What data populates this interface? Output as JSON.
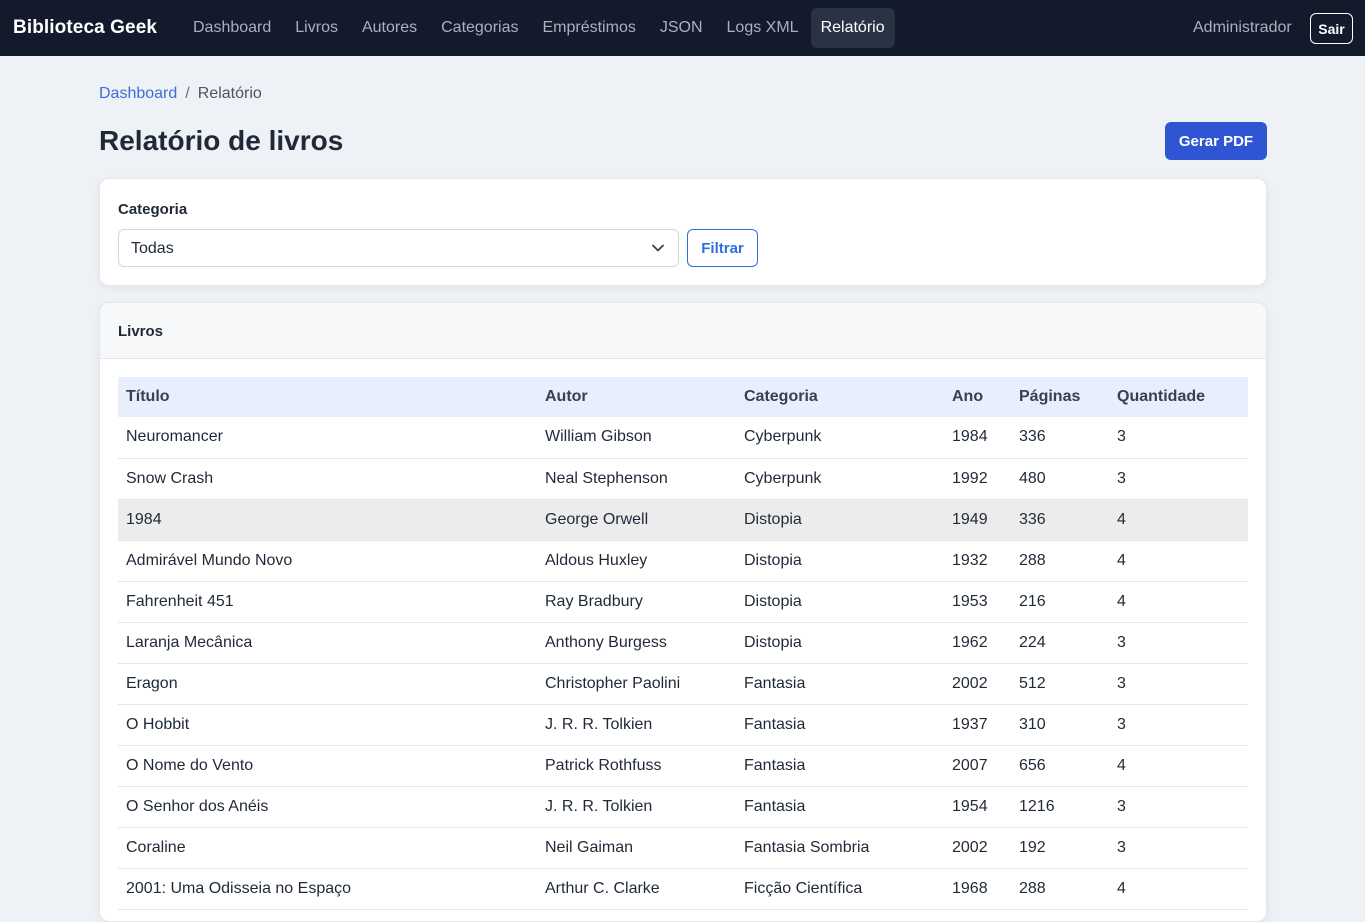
{
  "navbar": {
    "brand": "Biblioteca Geek",
    "links": [
      "Dashboard",
      "Livros",
      "Autores",
      "Categorias",
      "Empréstimos",
      "JSON",
      "Logs XML",
      "Relatório"
    ],
    "active": "Relatório",
    "user": "Administrador",
    "logout_label": "Sair"
  },
  "breadcrumb": {
    "home": "Dashboard",
    "separator": "/",
    "current": "Relatório"
  },
  "page": {
    "title": "Relatório de livros",
    "pdf_button": "Gerar PDF"
  },
  "filter": {
    "label": "Categoria",
    "selected": "Todas",
    "button": "Filtrar"
  },
  "books": {
    "title": "Livros",
    "columns": [
      "Título",
      "Autor",
      "Categoria",
      "Ano",
      "Páginas",
      "Quantidade"
    ],
    "rows": [
      [
        "Neuromancer",
        "William Gibson",
        "Cyberpunk",
        "1984",
        "336",
        "3"
      ],
      [
        "Snow Crash",
        "Neal Stephenson",
        "Cyberpunk",
        "1992",
        "480",
        "3"
      ],
      [
        "1984",
        "George Orwell",
        "Distopia",
        "1949",
        "336",
        "4"
      ],
      [
        "Admirável Mundo Novo",
        "Aldous Huxley",
        "Distopia",
        "1932",
        "288",
        "4"
      ],
      [
        "Fahrenheit 451",
        "Ray Bradbury",
        "Distopia",
        "1953",
        "216",
        "4"
      ],
      [
        "Laranja Mecânica",
        "Anthony Burgess",
        "Distopia",
        "1962",
        "224",
        "3"
      ],
      [
        "Eragon",
        "Christopher Paolini",
        "Fantasia",
        "2002",
        "512",
        "3"
      ],
      [
        "O Hobbit",
        "J. R. R. Tolkien",
        "Fantasia",
        "1937",
        "310",
        "3"
      ],
      [
        "O Nome do Vento",
        "Patrick Rothfuss",
        "Fantasia",
        "2007",
        "656",
        "4"
      ],
      [
        "O Senhor dos Anéis",
        "J. R. R. Tolkien",
        "Fantasia",
        "1954",
        "1216",
        "3"
      ],
      [
        "Coraline",
        "Neil Gaiman",
        "Fantasia Sombria",
        "2002",
        "192",
        "3"
      ],
      [
        "2001: Uma Odisseia no Espaço",
        "Arthur C. Clarke",
        "Ficção Científica",
        "1968",
        "288",
        "4"
      ]
    ],
    "highlighted_row": "1984"
  },
  "colors": {
    "navbar": "#121a2c",
    "primary": "#2f55d4",
    "link": "#3b6fd6",
    "page_bg": "#eef1f6",
    "table_header": "#e8eefb"
  },
  "icons": {
    "select_caret": "chevron-down-icon"
  }
}
